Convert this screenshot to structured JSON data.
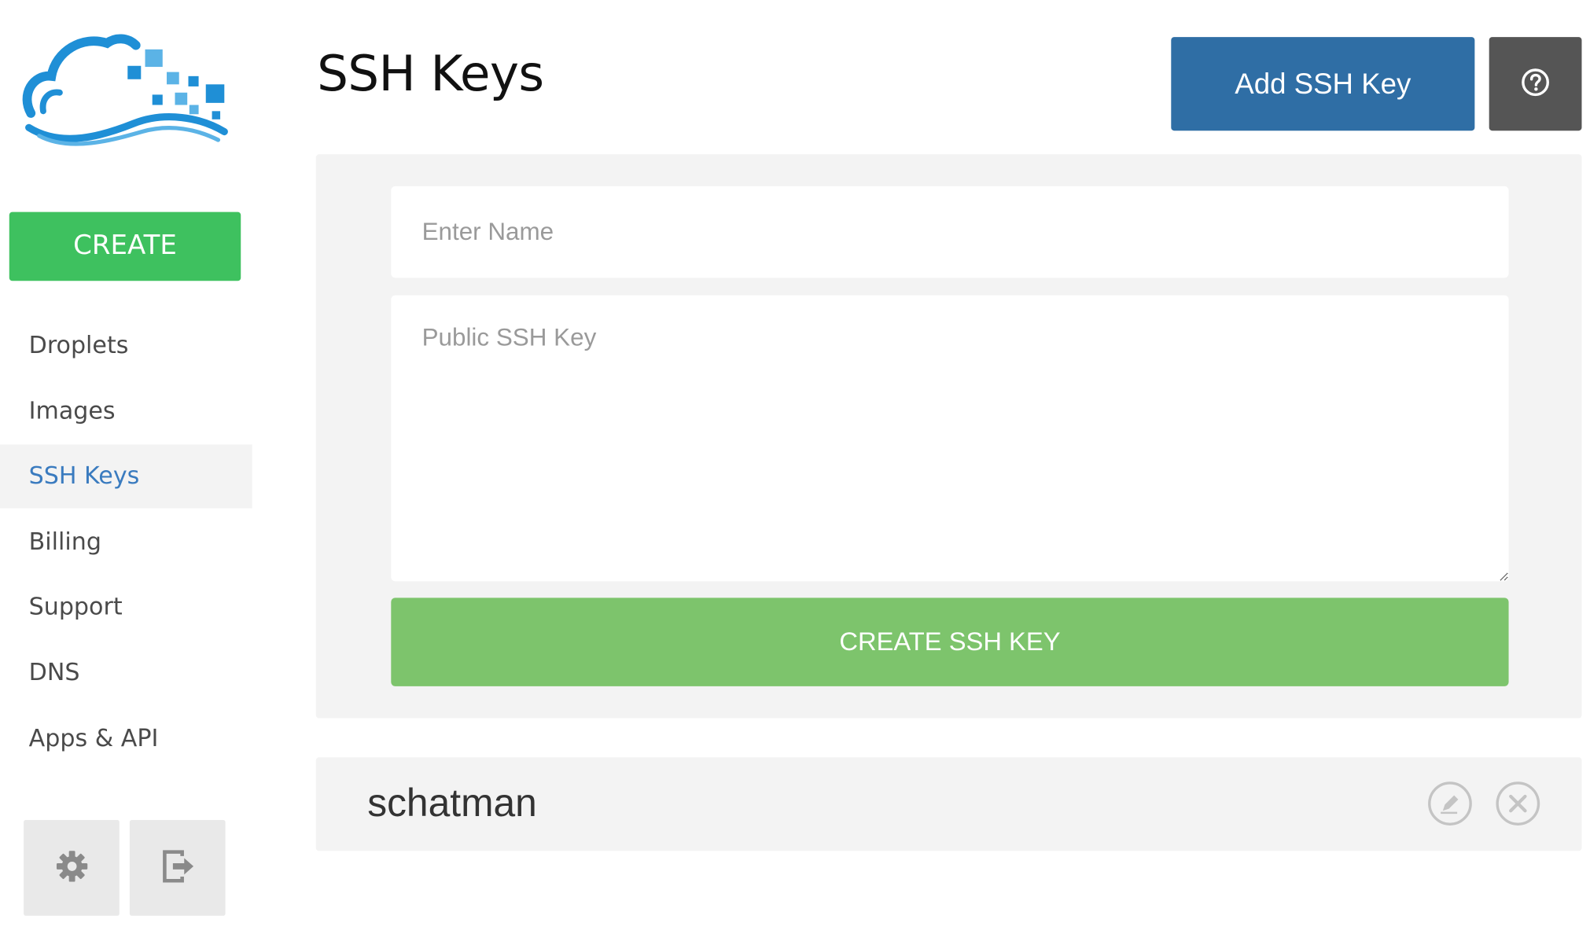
{
  "colors": {
    "create_green": "#3ec15f",
    "create_key_green": "#7dc46c",
    "primary_blue": "#2f6ea5",
    "active_nav_blue": "#3a7bbf",
    "help_dark": "#555555",
    "panel_bg": "#f3f3f3"
  },
  "sidebar": {
    "logo_icon": "cloud-logo-icon",
    "create_label": "CREATE",
    "items": [
      {
        "label": "Droplets",
        "active": false
      },
      {
        "label": "Images",
        "active": false
      },
      {
        "label": "SSH Keys",
        "active": true
      },
      {
        "label": "Billing",
        "active": false
      },
      {
        "label": "Support",
        "active": false
      },
      {
        "label": "DNS",
        "active": false
      },
      {
        "label": "Apps & API",
        "active": false
      }
    ],
    "settings_icon": "gear-icon",
    "logout_icon": "logout-icon"
  },
  "header": {
    "title": "SSH Keys",
    "add_button_label": "Add SSH Key",
    "help_icon": "question-circle-icon"
  },
  "form": {
    "name_placeholder": "Enter Name",
    "name_value": "",
    "key_placeholder": "Public SSH Key",
    "key_value": "",
    "submit_label": "CREATE SSH KEY"
  },
  "keys": [
    {
      "name": "schatman",
      "edit_icon": "pencil-icon",
      "delete_icon": "close-circle-icon"
    }
  ]
}
